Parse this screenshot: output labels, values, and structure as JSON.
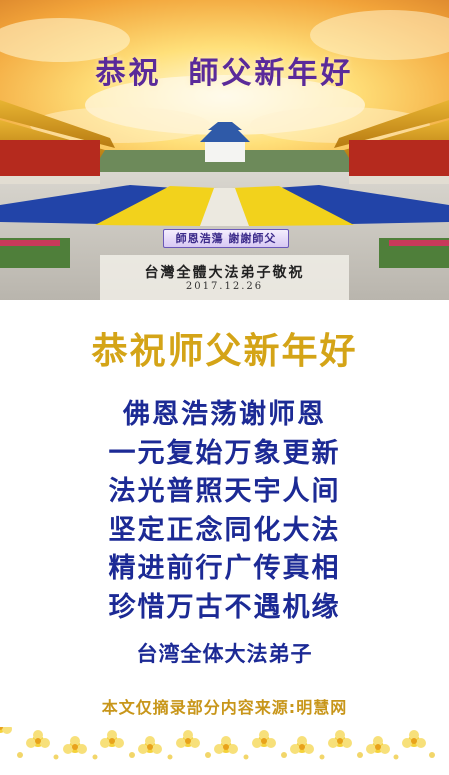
{
  "photo": {
    "title": "恭祝  師父新年好",
    "banner": "師恩浩蕩 謝謝師父",
    "subtitle": "台灣全體大法弟子敬祝",
    "date": "2017.12.26"
  },
  "headline": "恭祝师父新年好",
  "poem": [
    "佛恩浩荡谢师恩",
    "一元复始万象更新",
    "法光普照天宇人间",
    "坚定正念同化大法",
    "精进前行广传真相",
    "珍惜万古不遇机缘"
  ],
  "signature": "台湾全体大法弟子",
  "source": "本文仅摘录部分内容来源:明慧网",
  "colors": {
    "headline": "#d4a417",
    "poem": "#1c2a95",
    "source": "#c8961a",
    "photo_title": "#5a2a9a"
  }
}
